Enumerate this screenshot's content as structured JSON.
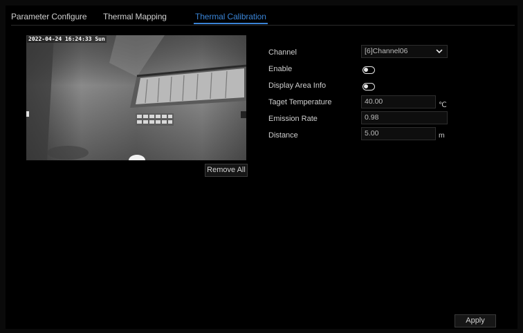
{
  "tabs": [
    {
      "label": "Parameter Configure",
      "active": false
    },
    {
      "label": "Thermal Mapping",
      "active": false
    },
    {
      "label": "Thermal Calibration",
      "active": true
    }
  ],
  "video": {
    "timestamp": "2022-04-24 16:24:33 Sun",
    "remove_all_label": "Remove All"
  },
  "form": {
    "channel": {
      "label": "Channel",
      "value": "[6]Channel06"
    },
    "enable": {
      "label": "Enable",
      "on": false
    },
    "display_area_info": {
      "label": "Display Area Info",
      "on": false
    },
    "target_temperature": {
      "label": "Taget Temperature",
      "value": "40.00",
      "unit": "℃"
    },
    "emission_rate": {
      "label": "Emission Rate",
      "value": "0.98"
    },
    "distance": {
      "label": "Distance",
      "value": "5.00",
      "unit": "m"
    }
  },
  "apply_label": "Apply",
  "colors": {
    "accent": "#3a84d6",
    "background": "#000000"
  }
}
